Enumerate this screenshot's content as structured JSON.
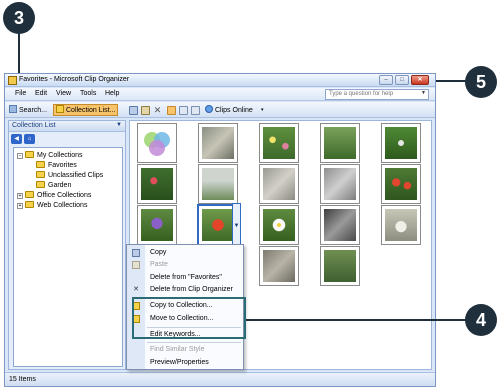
{
  "window": {
    "title": "Favorites - Microsoft Clip Organizer",
    "controls": {
      "minimize": "–",
      "maximize": "□",
      "close": "✕"
    }
  },
  "menu": {
    "items": [
      "File",
      "Edit",
      "View",
      "Tools",
      "Help"
    ],
    "help_placeholder": "Type a question for help"
  },
  "toolbar": {
    "search_label": "Search...",
    "collection_list_label": "Collection List...",
    "clips_online_label": "Clips Online"
  },
  "left_pane": {
    "header": "Collection List",
    "tree": [
      {
        "label": "My Collections",
        "expander": "−"
      },
      {
        "label": "Favorites"
      },
      {
        "label": "Unclassified Clips"
      },
      {
        "label": "Garden"
      },
      {
        "label": "Office Collections",
        "expander": "+"
      },
      {
        "label": "Web Collections",
        "expander": "+"
      }
    ]
  },
  "thumbnails": [
    "circles-diagram",
    "cat-photo",
    "flowers-photo",
    "yard-photo",
    "plant-photo",
    "roses-photo",
    "mailbox-photo",
    "rocks-photo",
    "stones-photo",
    "red-flowers-photo",
    "purple-flower-photo",
    "red-flower-photo",
    "white-daisy-photo",
    "machine-photo",
    "cup-photo",
    "rock-wall-photo",
    "garden-hose-photo"
  ],
  "context_menu": {
    "items": [
      {
        "label": "Copy",
        "icon": "copy-icon",
        "disabled": false
      },
      {
        "label": "Paste",
        "icon": "paste-icon",
        "disabled": true
      },
      {
        "label": "Delete from \"Favorites\"",
        "icon": "",
        "disabled": false
      },
      {
        "label": "Delete from Clip Organizer",
        "icon": "delete-icon",
        "disabled": false
      },
      {
        "label": "Copy to Collection...",
        "icon": "copy-collection-icon",
        "disabled": false
      },
      {
        "label": "Move to Collection...",
        "icon": "move-collection-icon",
        "disabled": false
      },
      {
        "label": "Edit Keywords...",
        "icon": "",
        "disabled": false
      },
      {
        "label": "Find Similar Style",
        "icon": "",
        "disabled": true
      },
      {
        "label": "Preview/Properties",
        "icon": "",
        "disabled": false
      }
    ]
  },
  "status": {
    "text": "15 Items"
  },
  "callouts": [
    "3",
    "4",
    "5"
  ],
  "colors": {
    "callout": "#1f2f3b",
    "highlight": "#2a6b74",
    "accent": "#316ac5",
    "toolbar_active": "#f7c46b"
  }
}
